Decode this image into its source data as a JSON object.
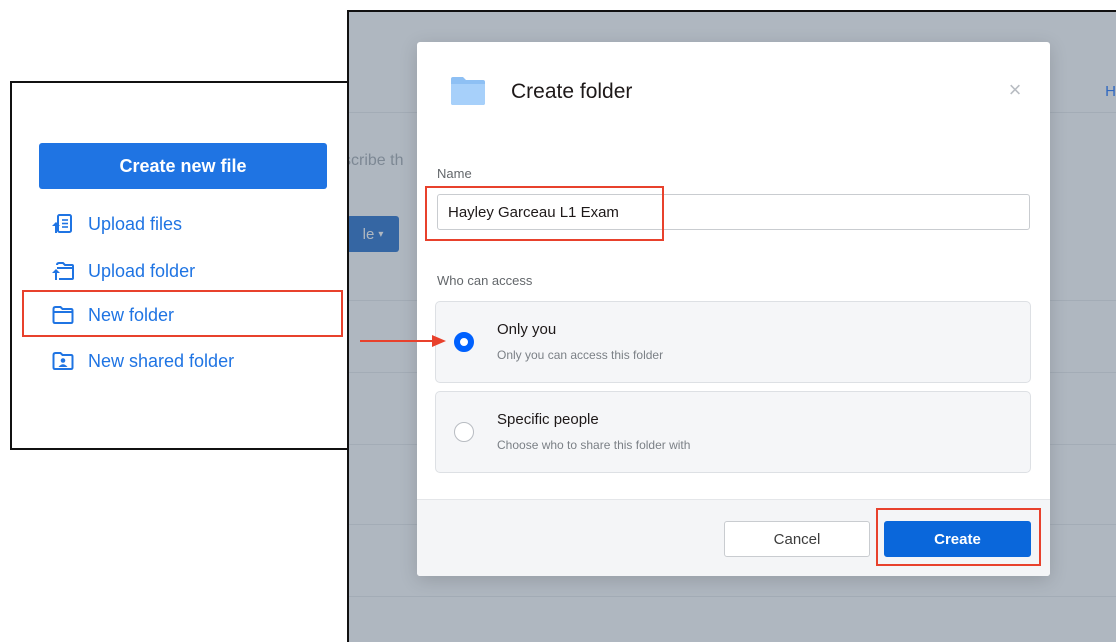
{
  "menu": {
    "create_button": "Create new file",
    "items": [
      {
        "label": "Upload files",
        "icon": "upload-files-icon"
      },
      {
        "label": "Upload folder",
        "icon": "upload-folder-icon"
      },
      {
        "label": "New folder",
        "icon": "folder-icon"
      },
      {
        "label": "New shared folder",
        "icon": "shared-folder-icon"
      }
    ]
  },
  "background": {
    "partial_text": "scribe th",
    "button_partial": "le",
    "top_right_partial": "H"
  },
  "modal": {
    "title": "Create folder",
    "close_icon": "close-icon",
    "name_label": "Name",
    "name_value": "Hayley Garceau L1 Exam",
    "access_label": "Who can access",
    "options": [
      {
        "title": "Only you",
        "description": "Only you can access this folder",
        "selected": true
      },
      {
        "title": "Specific people",
        "description": "Choose who to share this folder with",
        "selected": false
      }
    ],
    "cancel_label": "Cancel",
    "create_label": "Create"
  },
  "colors": {
    "accent": "#0061fe",
    "primary_button": "#0a67db",
    "highlight": "#e8412c",
    "overlay": "#8a97a6"
  }
}
